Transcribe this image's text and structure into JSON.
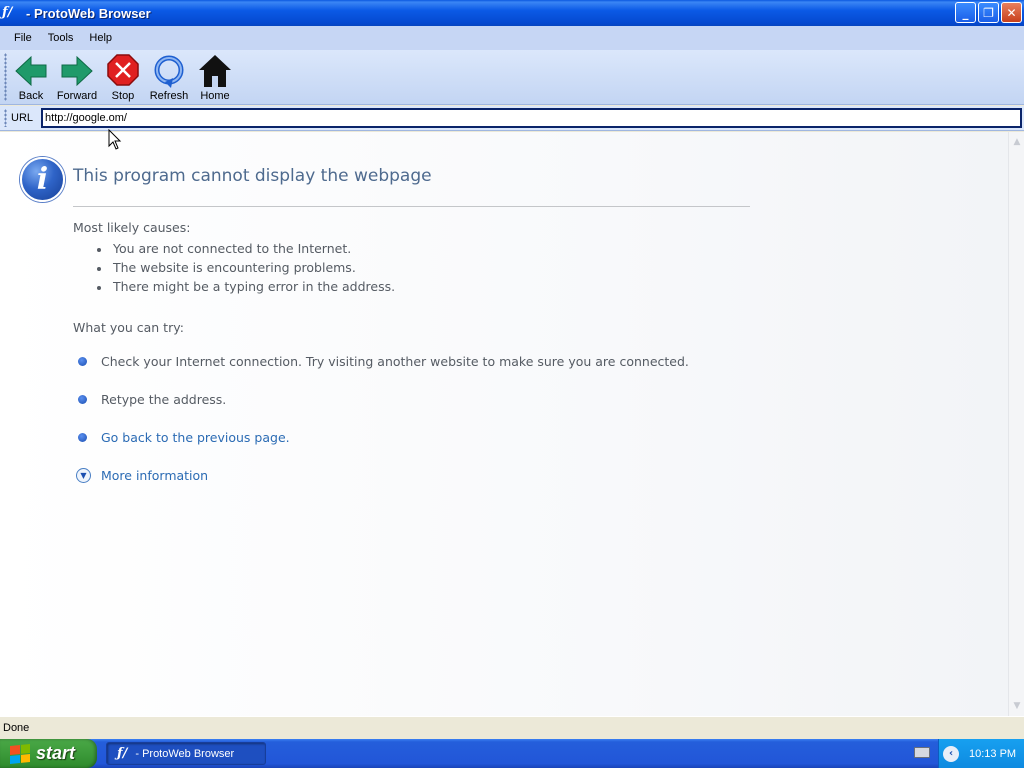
{
  "window": {
    "app_icon": "ƒ/",
    "title": " - ProtoWeb Browser",
    "buttons": {
      "minimize": "_",
      "maximize": "❐",
      "close": "✕"
    }
  },
  "menu": [
    "File",
    "Tools",
    "Help"
  ],
  "toolbar": {
    "back": "Back",
    "forward": "Forward",
    "stop": "Stop",
    "refresh": "Refresh",
    "home": "Home"
  },
  "address": {
    "label": "URL",
    "value": "http://google.om/"
  },
  "page": {
    "title": "This program cannot display the webpage",
    "causes_heading": "Most likely causes:",
    "causes": [
      "You are not connected to the Internet.",
      "The website is encountering problems.",
      "There might be a typing error in the address."
    ],
    "try_heading": "What you can try:",
    "try_items": [
      "Check your Internet connection. Try visiting another website to make sure you are connected.",
      "Retype the address.",
      "Go back to the previous page."
    ],
    "more_info": "More information"
  },
  "status": "Done",
  "taskbar": {
    "start": "start",
    "task_icon": "ƒ/",
    "task_label": "- ProtoWeb Browser",
    "clock": "10:13 PM"
  },
  "colors": {
    "title_blue": "#0549d0",
    "link": "#2b6bb4",
    "heading": "#4e6a8e",
    "start_green": "#3c9a3a"
  },
  "icons": {
    "back": "left-arrow-icon",
    "forward": "right-arrow-icon",
    "stop": "stop-sign-icon",
    "refresh": "refresh-icon",
    "home": "home-icon",
    "info": "info-icon"
  }
}
